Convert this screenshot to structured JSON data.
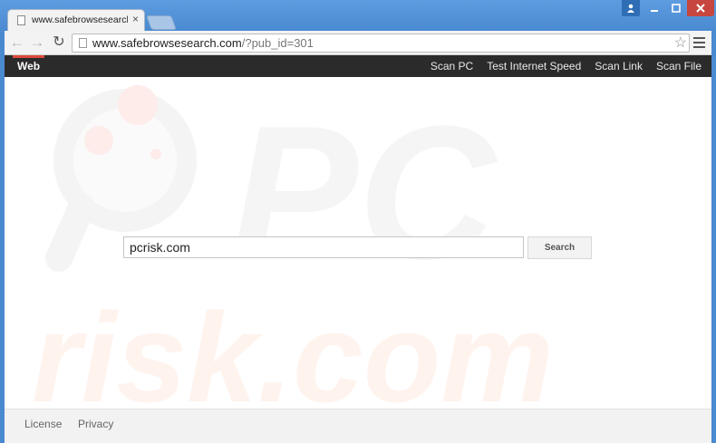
{
  "browser": {
    "tab_title": "www.safebrowsesearch.co",
    "tab_close": "×",
    "url_host": "www.safebrowsesearch.com",
    "url_query": "/?pub_id=301"
  },
  "nav": {
    "web_label": "Web",
    "links": [
      "Scan PC",
      "Test Internet Speed",
      "Scan Link",
      "Scan File"
    ]
  },
  "search": {
    "value": "pcrisk.com",
    "button_label": "Search"
  },
  "footer": {
    "license": "License",
    "privacy": "Privacy"
  },
  "watermark": {
    "text": "risk.com"
  },
  "colors": {
    "window_frame": "#4a8ad0",
    "nav_bar": "#2b2b2b",
    "nav_accent": "#dd4b39",
    "close_button": "#c7463f"
  }
}
